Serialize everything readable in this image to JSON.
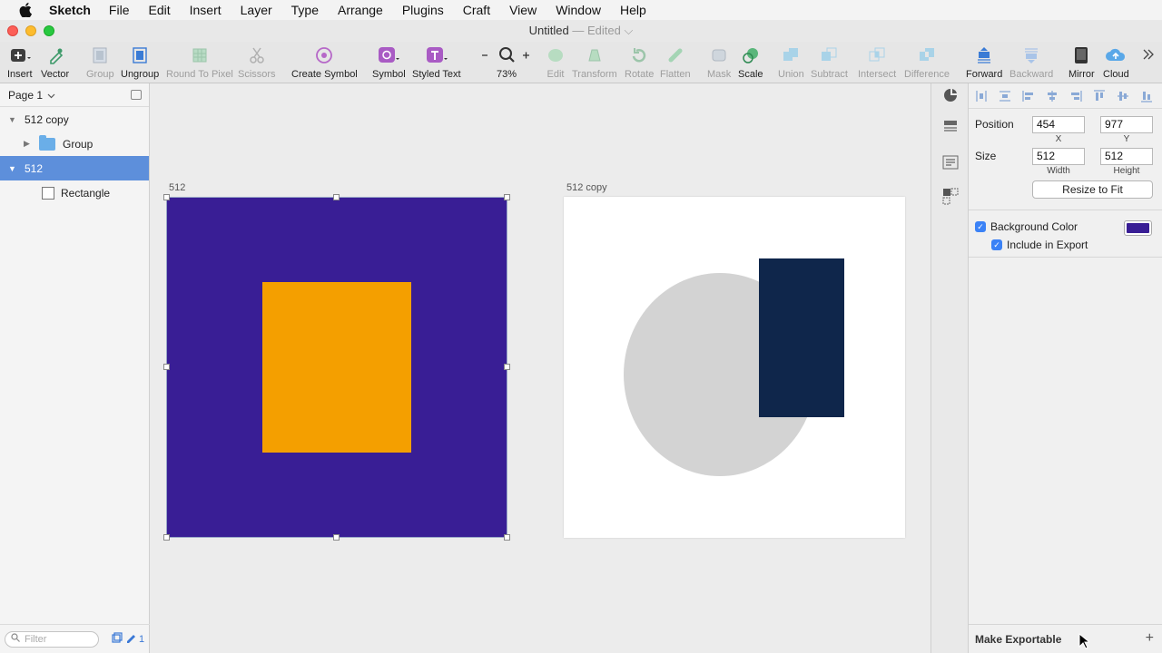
{
  "menubar": {
    "app": "Sketch",
    "items": [
      "File",
      "Edit",
      "Insert",
      "Layer",
      "Type",
      "Arrange",
      "Plugins",
      "Craft",
      "View",
      "Window",
      "Help"
    ]
  },
  "window": {
    "title": "Untitled",
    "edited": "— Edited"
  },
  "toolbar": {
    "insert": "Insert",
    "vector": "Vector",
    "group": "Group",
    "ungroup": "Ungroup",
    "round_to_pixel": "Round To Pixel",
    "scissors": "Scissors",
    "create_symbol": "Create Symbol",
    "symbol": "Symbol",
    "styled_text": "Styled Text",
    "zoom": "73%",
    "edit": "Edit",
    "transform": "Transform",
    "rotate": "Rotate",
    "flatten": "Flatten",
    "mask": "Mask",
    "scale": "Scale",
    "union": "Union",
    "subtract": "Subtract",
    "intersect": "Intersect",
    "difference": "Difference",
    "forward": "Forward",
    "backward": "Backward",
    "mirror": "Mirror",
    "cloud": "Cloud"
  },
  "sidebar": {
    "page": "Page 1",
    "layers": [
      {
        "label": "512 copy"
      },
      {
        "label": "Group"
      },
      {
        "label": "512"
      },
      {
        "label": "Rectangle"
      }
    ],
    "filter_placeholder": "Filter",
    "filter_count": "1"
  },
  "canvas": {
    "artboard1_label": "512",
    "artboard2_label": "512 copy"
  },
  "inspector": {
    "position_label": "Position",
    "x": "454",
    "y": "977",
    "x_label": "X",
    "y_label": "Y",
    "size_label": "Size",
    "width": "512",
    "height": "512",
    "width_label": "Width",
    "height_label": "Height",
    "resize_to_fit": "Resize to Fit",
    "background_color_label": "Background Color",
    "include_in_export_label": "Include in Export",
    "make_exportable": "Make Exportable"
  },
  "colors": {
    "artboard1_bg": "#391e95",
    "orange_rect": "#f49f00",
    "circle": "#d3d3d3",
    "navy_rect": "#0f264b",
    "selection": "#5d8fdb"
  }
}
